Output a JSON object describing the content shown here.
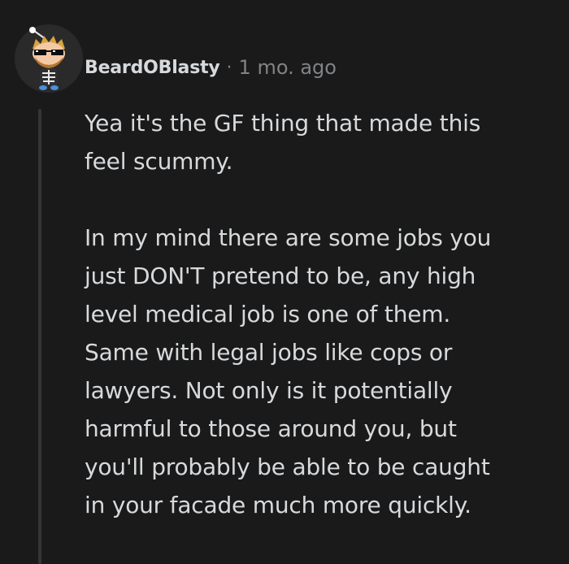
{
  "comment": {
    "author": "BeardOBlasty",
    "separator": "·",
    "timestamp": "1 mo. ago",
    "paragraphs": [
      "Yea it's the GF thing that made this\nfeel scummy.",
      "In my mind there are some jobs you\njust DON'T pretend to be, any high\nlevel medical job is one of them.\nSame with legal jobs like cops or\nlawyers. Not only is it potentially\nharmful to those around you, but\nyou'll probably be able to be caught\nin your facade much more quickly."
    ]
  },
  "colors": {
    "background": "#1a1a1b",
    "text": "#d7dadc",
    "meta": "#818384",
    "thread_line": "#343536"
  },
  "icons": {
    "avatar": "snoo-avatar-sunglasses-skeleton"
  }
}
